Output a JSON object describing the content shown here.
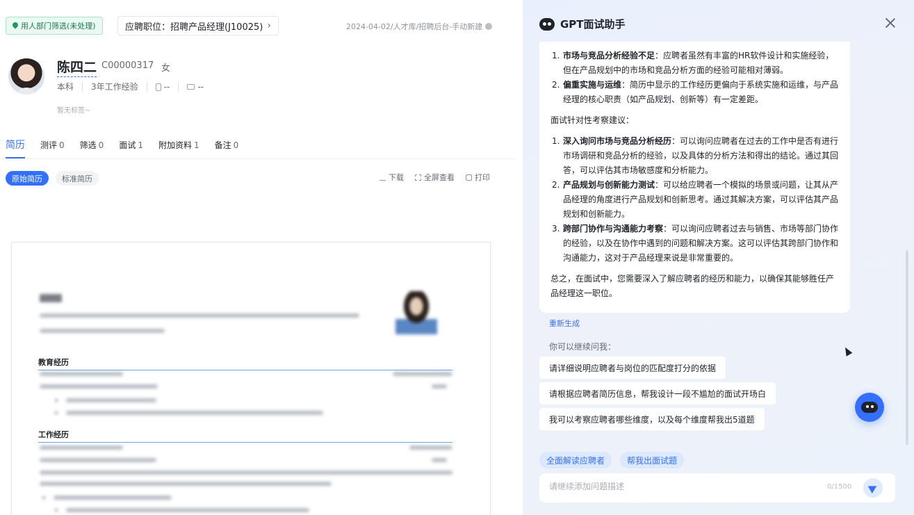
{
  "header": {
    "status_tag": "用人部门筛选(未处理)",
    "job_tag": "应聘职位：招聘产品经理(J10025)",
    "date_source": "2024-04-02/人才库/招聘后台-手动新建"
  },
  "candidate": {
    "name": "陈四二",
    "id": "C00000317",
    "gender": "女",
    "education": "本科",
    "experience": "3年工作经验",
    "phone": "--",
    "email": "--",
    "no_tag": "暂无标签~"
  },
  "tabs": [
    {
      "label": "简历",
      "count": ""
    },
    {
      "label": "测评",
      "count": "0"
    },
    {
      "label": "筛选",
      "count": "0"
    },
    {
      "label": "面试",
      "count": "1"
    },
    {
      "label": "附加资料",
      "count": "1"
    },
    {
      "label": "备注",
      "count": "0"
    }
  ],
  "resume_view": {
    "original": "原始简历",
    "standard": "标准简历",
    "download": "下载",
    "fullscreen": "全屏查看",
    "print": "打印"
  },
  "resume_doc": {
    "education_section": "教育经历",
    "work_section": "工作经历"
  },
  "gpt": {
    "title": "GPT面试助手",
    "weak_points": [
      {
        "num": "1.",
        "title": "市场与竞品分析经验不足",
        "text": "：应聘者虽然有丰富的HR软件设计和实施经验，但在产品规划中的市场和竞品分析方面的经验可能相对薄弱。"
      },
      {
        "num": "2.",
        "title": "偏重实施与运维",
        "text": "：简历中显示的工作经历更偏向于系统实施和运维，与产品经理的核心职责（如产品规划、创新等）有一定差距。"
      }
    ],
    "suggest_intro": "面试针对性考察建议：",
    "suggestions": [
      {
        "num": "1.",
        "title": "深入询问市场与竞品分析经历",
        "text": "：可以询问应聘者在过去的工作中是否有进行市场调研和竞品分析的经验，以及具体的分析方法和得出的结论。通过其回答，可以评估其市场敏感度和分析能力。"
      },
      {
        "num": "2.",
        "title": "产品规划与创新能力测试",
        "text": "：可以给应聘者一个模拟的场景或问题，让其从产品经理的角度进行产品规划和创新思考。通过其解决方案，可以评估其产品规划和创新能力。"
      },
      {
        "num": "3.",
        "title": "跨部门协作与沟通能力考察",
        "text": "：可以询问应聘者过去与销售、市场等部门协作的经验，以及在协作中遇到的问题和解决方案。这可以评估其跨部门协作和沟通能力，这对于产品经理来说是非常重要的。"
      }
    ],
    "summary": "总之，在面试中，您需要深入了解应聘者的经历和能力，以确保其能够胜任产品经理这一职位。",
    "regenerate": "重新生成",
    "continue_label": "你可以继续问我：",
    "prompts": [
      "请详细说明应聘者与岗位的匹配度打分的依据",
      "请根据应聘者简历信息，帮我设计一段不尴尬的面试开场白",
      "我可以考察应聘者哪些维度，以及每个维度帮我出5道题"
    ],
    "chips": [
      "全面解读应聘者",
      "帮我出面试题"
    ],
    "input_placeholder": "请继续添加问题描述",
    "counter": "0/1500"
  }
}
